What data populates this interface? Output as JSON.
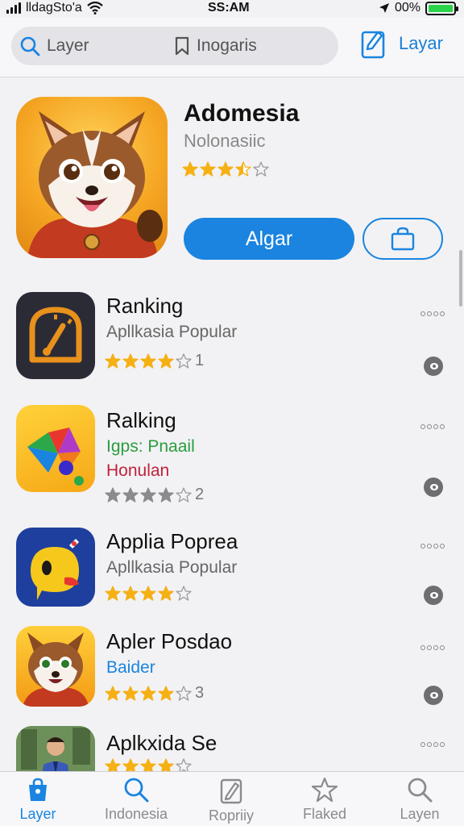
{
  "status_bar": {
    "carrier": "lldagSto'a",
    "time": "SS:AM",
    "battery": "00%"
  },
  "header": {
    "search_text_a": "Layer",
    "search_text_b": "Inogaris",
    "right_label": "Layar"
  },
  "featured": {
    "title": "Adomesia",
    "subtitle": "Nolonasiic",
    "rating": 3.5,
    "get_label": "Algar"
  },
  "apps": [
    {
      "title": "Ranking",
      "subtitle": "Apllkasia Popular",
      "subtitle2": "",
      "rating": 4,
      "count": "1"
    },
    {
      "title": "Ralking",
      "subtitle": "Igps: Pnaail",
      "subtitle2": "Honulan",
      "rating": 4,
      "count": "2"
    },
    {
      "title": "Applia Poprea",
      "subtitle": "Apllkasia Popular",
      "subtitle2": "",
      "rating": 4,
      "count": ""
    },
    {
      "title": "Apler Posdao",
      "subtitle": "Baider",
      "subtitle2": "",
      "rating": 4,
      "count": "3"
    },
    {
      "title": "Aplkxida Se",
      "subtitle": "",
      "subtitle2": "",
      "rating": 4,
      "count": ""
    }
  ],
  "tabs": [
    {
      "label": "Layer",
      "icon": "bag-icon"
    },
    {
      "label": "Indonesia",
      "icon": "search-icon"
    },
    {
      "label": "Ropriiy",
      "icon": "edit-icon"
    },
    {
      "label": "Flaked",
      "icon": "star-icon"
    },
    {
      "label": "Layen",
      "icon": "search-icon"
    }
  ],
  "colors": {
    "accent": "#1a84e0",
    "star": "#f5b014",
    "green_text": "#2a9d3c",
    "red_text": "#c0213b",
    "blue_text": "#1a84e0"
  }
}
